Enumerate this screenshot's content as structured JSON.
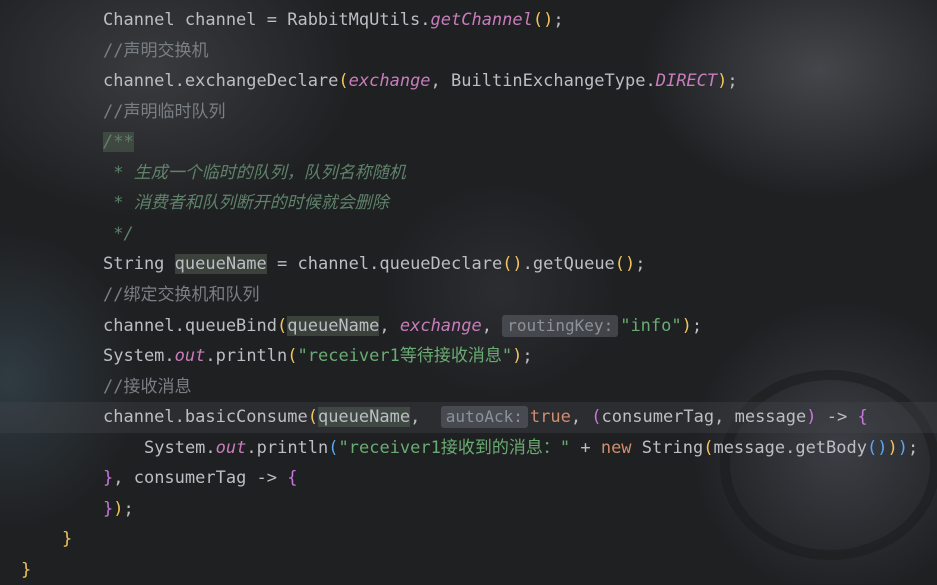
{
  "editor": {
    "lines": [
      {
        "tokens": [
          {
            "t": "Channel channel = RabbitMqUtils.",
            "c": "op"
          },
          {
            "t": "getChannel",
            "c": "field"
          },
          {
            "t": "()",
            "c": "p1"
          },
          {
            "t": ";",
            "c": "op"
          }
        ]
      },
      {
        "tokens": [
          {
            "t": "//声明交换机",
            "c": "cm"
          }
        ]
      },
      {
        "tokens": [
          {
            "t": "channel.exchangeDeclare",
            "c": "op"
          },
          {
            "t": "(",
            "c": "p1"
          },
          {
            "t": "exchange",
            "c": "param"
          },
          {
            "t": ", BuiltinExchangeType.",
            "c": "op"
          },
          {
            "t": "DIRECT",
            "c": "field"
          },
          {
            "t": ")",
            "c": "p1"
          },
          {
            "t": ";",
            "c": "op"
          }
        ]
      },
      {
        "tokens": [
          {
            "t": "//声明临时队列",
            "c": "cm"
          }
        ]
      },
      {
        "tokens": [
          {
            "t": "/**",
            "c": "doc hl"
          }
        ]
      },
      {
        "tokens": [
          {
            "t": " * 生成一个临时的队列，队列名称随机",
            "c": "doc"
          }
        ]
      },
      {
        "tokens": [
          {
            "t": " * 消费者和队列断开的时候就会删除",
            "c": "doc"
          }
        ]
      },
      {
        "tokens": [
          {
            "t": " */",
            "c": "doc"
          }
        ]
      },
      {
        "tokens": [
          {
            "t": "String ",
            "c": "op"
          },
          {
            "t": "queueName",
            "c": "op hl"
          },
          {
            "t": " = channel.queueDeclare",
            "c": "op"
          },
          {
            "t": "()",
            "c": "p1"
          },
          {
            "t": ".getQueue",
            "c": "op"
          },
          {
            "t": "()",
            "c": "p1"
          },
          {
            "t": ";",
            "c": "op"
          }
        ]
      },
      {
        "tokens": [
          {
            "t": "//绑定交换机和队列",
            "c": "cm"
          }
        ]
      },
      {
        "tokens": [
          {
            "t": "channel.queueBind",
            "c": "op"
          },
          {
            "t": "(",
            "c": "p1"
          },
          {
            "t": "queueName",
            "c": "op hl"
          },
          {
            "t": ", ",
            "c": "op"
          },
          {
            "t": "exchange",
            "c": "param"
          },
          {
            "t": ", ",
            "c": "op"
          },
          {
            "t": "routingKey:",
            "c": "hint"
          },
          {
            "t": "\"info\"",
            "c": "str"
          },
          {
            "t": ")",
            "c": "p1"
          },
          {
            "t": ";",
            "c": "op"
          }
        ]
      },
      {
        "tokens": [
          {
            "t": "System.",
            "c": "op"
          },
          {
            "t": "out",
            "c": "field"
          },
          {
            "t": ".println",
            "c": "op"
          },
          {
            "t": "(",
            "c": "p1"
          },
          {
            "t": "\"receiver1等待接收消息\"",
            "c": "str"
          },
          {
            "t": ")",
            "c": "p1"
          },
          {
            "t": ";",
            "c": "op"
          }
        ]
      },
      {
        "tokens": [
          {
            "t": "//接收消息",
            "c": "cm"
          }
        ]
      },
      {
        "current": true,
        "tokens": [
          {
            "t": "channel.basicConsume",
            "c": "op"
          },
          {
            "t": "(",
            "c": "p1"
          },
          {
            "t": "queueName",
            "c": "op hl"
          },
          {
            "t": ",  ",
            "c": "op"
          },
          {
            "t": "autoAck:",
            "c": "hint"
          },
          {
            "t": "true",
            "c": "kw"
          },
          {
            "t": ", ",
            "c": "op"
          },
          {
            "t": "(",
            "c": "p2"
          },
          {
            "t": "consumerTag, message",
            "c": "op"
          },
          {
            "t": ")",
            "c": "p2"
          },
          {
            "t": " -> ",
            "c": "op"
          },
          {
            "t": "{",
            "c": "p2"
          }
        ]
      },
      {
        "indent": 1,
        "tokens": [
          {
            "t": "System.",
            "c": "op"
          },
          {
            "t": "out",
            "c": "field"
          },
          {
            "t": ".println",
            "c": "op"
          },
          {
            "t": "(",
            "c": "p3"
          },
          {
            "t": "\"receiver1接收到的消息：\"",
            "c": "str"
          },
          {
            "t": " + ",
            "c": "op"
          },
          {
            "t": "new ",
            "c": "kw"
          },
          {
            "t": "String",
            "c": "op"
          },
          {
            "t": "(",
            "c": "p1"
          },
          {
            "t": "message.getBody",
            "c": "op"
          },
          {
            "t": "()",
            "c": "p3"
          },
          {
            "t": ")",
            "c": "p1"
          },
          {
            "t": ")",
            "c": "p3"
          },
          {
            "t": ";",
            "c": "op"
          }
        ]
      },
      {
        "tokens": [
          {
            "t": "}",
            "c": "p2"
          },
          {
            "t": ", consumerTag -> ",
            "c": "op"
          },
          {
            "t": "{",
            "c": "p2"
          }
        ]
      },
      {
        "tokens": [
          {
            "t": "}",
            "c": "p2"
          },
          {
            "t": ")",
            "c": "p1"
          },
          {
            "t": ";",
            "c": "op"
          }
        ]
      },
      {
        "outdent": 1,
        "tokens": [
          {
            "t": "}",
            "c": "p1"
          }
        ]
      },
      {
        "outdent": 2,
        "tokens": [
          {
            "t": "}",
            "c": "p1"
          }
        ]
      }
    ]
  }
}
